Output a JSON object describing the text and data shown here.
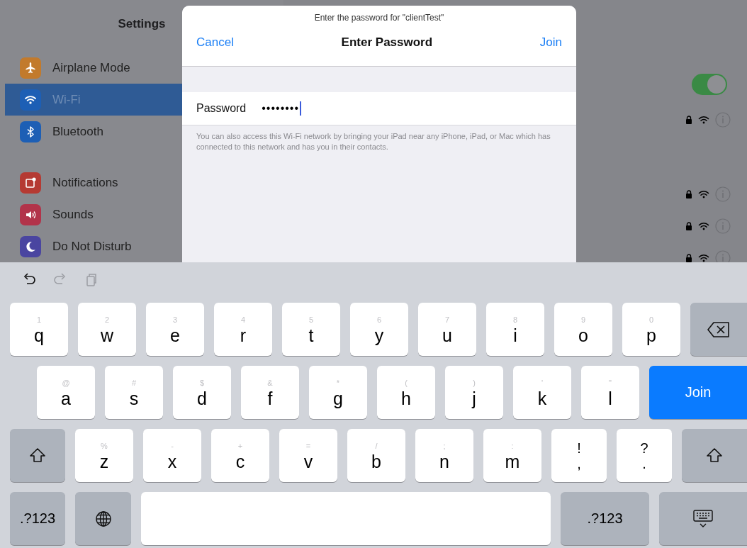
{
  "settings": {
    "title": "Settings",
    "sections": [
      [
        {
          "label": "Airplane Mode",
          "kind": "airplane",
          "color": "#c27a2c",
          "selected": false
        },
        {
          "label": "Wi-Fi",
          "kind": "wifi",
          "color": "#1d5fb5",
          "selected": true
        },
        {
          "label": "Bluetooth",
          "kind": "bluetooth",
          "color": "#1d5fb5",
          "selected": false
        }
      ],
      [
        {
          "label": "Notifications",
          "kind": "notifications",
          "color": "#b53a33",
          "selected": false
        },
        {
          "label": "Sounds",
          "kind": "sounds",
          "color": "#b2334a",
          "selected": false
        },
        {
          "label": "Do Not Disturb",
          "kind": "moon",
          "color": "#4a45a0",
          "selected": false
        }
      ]
    ],
    "wifi_switch": {
      "on": true
    },
    "networks": [
      {
        "locked": true
      },
      {
        "locked": true
      },
      {
        "locked": true
      },
      {
        "locked": true
      }
    ]
  },
  "dialog": {
    "subtitle": "Enter the password for \"clientTest\"",
    "cancel": "Cancel",
    "title": "Enter Password",
    "join": "Join",
    "field": {
      "label": "Password",
      "value": "••••••••"
    },
    "footnote": "You can also access this Wi-Fi network by bringing your iPad near any iPhone, iPad, or Mac which has connected to this network and has you in their contacts."
  },
  "keyboard": {
    "toolbar": [
      {
        "kind": "undo",
        "disabled": false
      },
      {
        "kind": "redo",
        "disabled": true
      },
      {
        "kind": "paste",
        "disabled": true
      }
    ],
    "rows": [
      [
        {
          "kind": "letter",
          "label": "q",
          "hint": "1"
        },
        {
          "kind": "letter",
          "label": "w",
          "hint": "2"
        },
        {
          "kind": "letter",
          "label": "e",
          "hint": "3"
        },
        {
          "kind": "letter",
          "label": "r",
          "hint": "4"
        },
        {
          "kind": "letter",
          "label": "t",
          "hint": "5"
        },
        {
          "kind": "letter",
          "label": "y",
          "hint": "6"
        },
        {
          "kind": "letter",
          "label": "u",
          "hint": "7"
        },
        {
          "kind": "letter",
          "label": "i",
          "hint": "8"
        },
        {
          "kind": "letter",
          "label": "o",
          "hint": "9"
        },
        {
          "kind": "letter",
          "label": "p",
          "hint": "0"
        },
        {
          "kind": "backspace"
        }
      ],
      [
        {
          "kind": "letter",
          "label": "a",
          "hint": "@"
        },
        {
          "kind": "letter",
          "label": "s",
          "hint": "#"
        },
        {
          "kind": "letter",
          "label": "d",
          "hint": "$"
        },
        {
          "kind": "letter",
          "label": "f",
          "hint": "&"
        },
        {
          "kind": "letter",
          "label": "g",
          "hint": "*"
        },
        {
          "kind": "letter",
          "label": "h",
          "hint": "("
        },
        {
          "kind": "letter",
          "label": "j",
          "hint": ")"
        },
        {
          "kind": "letter",
          "label": "k",
          "hint": "'"
        },
        {
          "kind": "letter",
          "label": "l",
          "hint": "\""
        },
        {
          "kind": "return",
          "label": "Join"
        }
      ],
      [
        {
          "kind": "shift"
        },
        {
          "kind": "letter",
          "label": "z",
          "hint": "%"
        },
        {
          "kind": "letter",
          "label": "x",
          "hint": "-"
        },
        {
          "kind": "letter",
          "label": "c",
          "hint": "+"
        },
        {
          "kind": "letter",
          "label": "v",
          "hint": "="
        },
        {
          "kind": "letter",
          "label": "b",
          "hint": "/"
        },
        {
          "kind": "letter",
          "label": "n",
          "hint": ";"
        },
        {
          "kind": "letter",
          "label": "m",
          "hint": ":"
        },
        {
          "kind": "punct",
          "label": ",",
          "hint": "!"
        },
        {
          "kind": "punct",
          "label": ".",
          "hint": "?"
        },
        {
          "kind": "shift"
        }
      ],
      [
        {
          "kind": "mode",
          "label": ".?123"
        },
        {
          "kind": "globe"
        },
        {
          "kind": "space"
        },
        {
          "kind": "mode",
          "label": ".?123"
        },
        {
          "kind": "dismiss"
        }
      ]
    ]
  }
}
